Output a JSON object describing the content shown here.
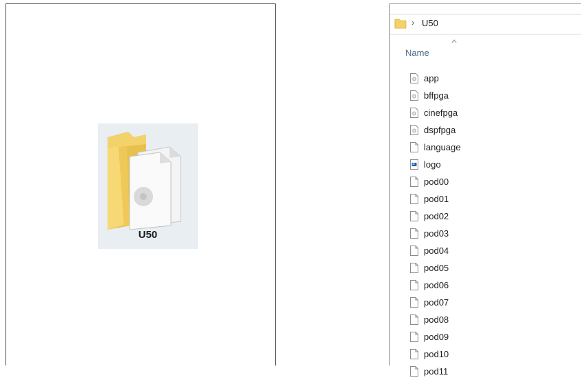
{
  "folder_view": {
    "folder_name": "U50"
  },
  "explorer": {
    "address": {
      "separator": "›",
      "path": "U50"
    },
    "column_header": "Name",
    "files": [
      {
        "name": "app",
        "icon": "system-file-icon"
      },
      {
        "name": "bffpga",
        "icon": "system-file-icon"
      },
      {
        "name": "cinefpga",
        "icon": "system-file-icon"
      },
      {
        "name": "dspfpga",
        "icon": "system-file-icon"
      },
      {
        "name": "language",
        "icon": "blank-file-icon"
      },
      {
        "name": "logo",
        "icon": "image-file-icon"
      },
      {
        "name": "pod00",
        "icon": "blank-file-icon"
      },
      {
        "name": "pod01",
        "icon": "blank-file-icon"
      },
      {
        "name": "pod02",
        "icon": "blank-file-icon"
      },
      {
        "name": "pod03",
        "icon": "blank-file-icon"
      },
      {
        "name": "pod04",
        "icon": "blank-file-icon"
      },
      {
        "name": "pod05",
        "icon": "blank-file-icon"
      },
      {
        "name": "pod06",
        "icon": "blank-file-icon"
      },
      {
        "name": "pod07",
        "icon": "blank-file-icon"
      },
      {
        "name": "pod08",
        "icon": "blank-file-icon"
      },
      {
        "name": "pod09",
        "icon": "blank-file-icon"
      },
      {
        "name": "pod10",
        "icon": "blank-file-icon"
      },
      {
        "name": "pod11",
        "icon": "blank-file-icon"
      }
    ]
  }
}
